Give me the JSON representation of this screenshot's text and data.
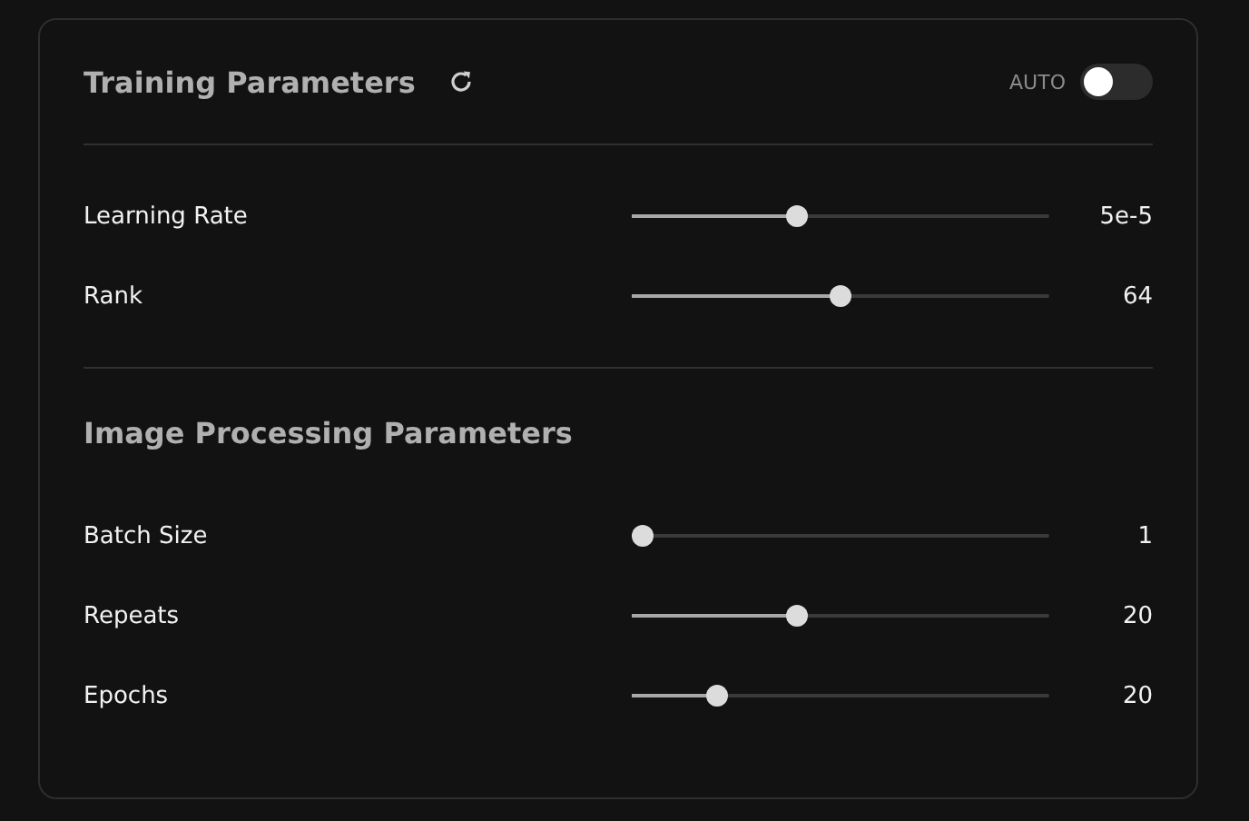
{
  "sections": [
    {
      "kind": "main",
      "title": "Training Parameters",
      "auto": {
        "label": "AUTO",
        "on": false
      },
      "params": [
        {
          "label": "Learning Rate",
          "level": 0.39,
          "reading": "5e-5"
        },
        {
          "label": "Rank",
          "level": 0.5,
          "reading": "64"
        }
      ]
    },
    {
      "kind": "sub",
      "title": "Image Processing Parameters",
      "params": [
        {
          "label": "Batch Size",
          "level": 0,
          "reading": "1"
        },
        {
          "label": "Repeats",
          "level": 0.39,
          "reading": "20"
        },
        {
          "label": "Epochs",
          "level": 0.19,
          "reading": "20"
        }
      ]
    }
  ]
}
